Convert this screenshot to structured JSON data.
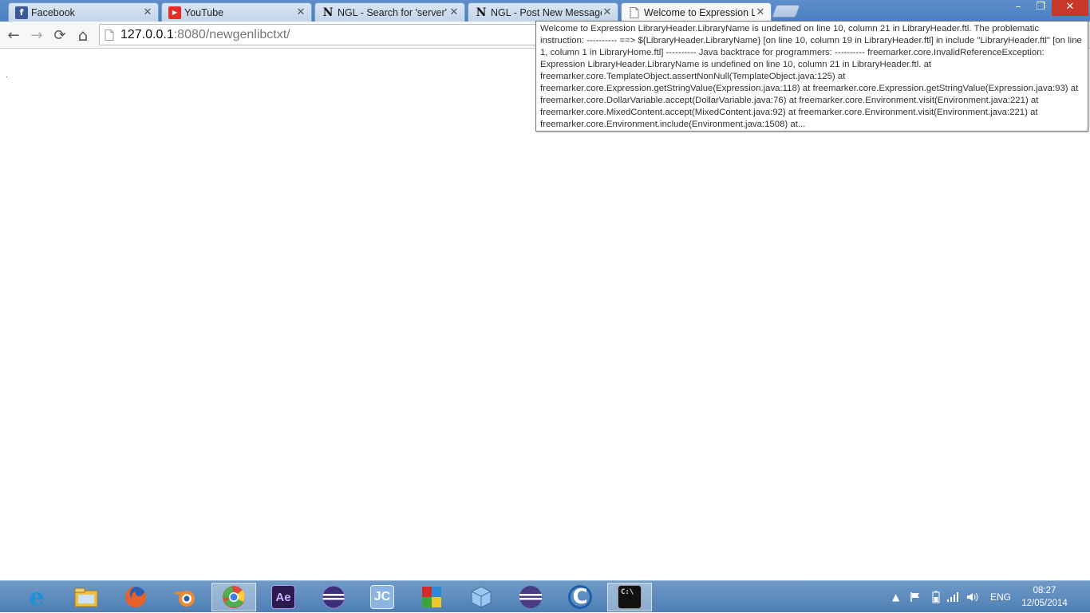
{
  "browser": {
    "tabs": [
      {
        "label": "Facebook",
        "icon": "facebook-icon",
        "active": false
      },
      {
        "label": "YouTube",
        "icon": "youtube-icon",
        "active": false
      },
      {
        "label": "NGL - Search for 'server'",
        "icon": "ngl-icon",
        "active": false
      },
      {
        "label": "NGL - Post New Message",
        "icon": "ngl-icon",
        "active": false
      },
      {
        "label": "Welcome to Expression Lil",
        "icon": "page-icon",
        "active": true
      }
    ],
    "window_controls": {
      "minimize": "–",
      "maximize": "❐",
      "close": "✕"
    },
    "toolbar": {
      "back": "←",
      "forward": "→",
      "reload": "⟳",
      "home": "⌂",
      "url_host": "127.0.0.1",
      "url_rest": ":8080/newgenlibctxt/"
    }
  },
  "page": {
    "tooltip_text": "Welcome to Expression LibraryHeader.LibraryName is undefined on line 10, column 21 in LibraryHeader.ftl. The problematic instruction: ---------- ==> ${LibraryHeader.LibraryName} [on line 10, column 19 in LibraryHeader.ftl] in include \"LibraryHeader.ftl\" [on line 1, column 1 in LibraryHome.ftl] ---------- Java backtrace for programmers: ---------- freemarker.core.InvalidReferenceException: Expression LibraryHeader.LibraryName is undefined on line 10, column 21 in LibraryHeader.ftl. at freemarker.core.TemplateObject.assertNonNull(TemplateObject.java:125) at freemarker.core.Expression.getStringValue(Expression.java:118) at freemarker.core.Expression.getStringValue(Expression.java:93) at freemarker.core.DollarVariable.accept(DollarVariable.java:76) at freemarker.core.Environment.visit(Environment.java:221) at freemarker.core.MixedContent.accept(MixedContent.java:92) at freemarker.core.Environment.visit(Environment.java:221) at freemarker.core.Environment.include(Environment.java:1508) at..."
  },
  "taskbar": {
    "apps": [
      {
        "name": "internet-explorer-icon",
        "glyph": "e",
        "color": "#1e90d8"
      },
      {
        "name": "file-explorer-icon",
        "glyph": "",
        "color": "#e8c04a"
      },
      {
        "name": "firefox-icon",
        "glyph": "",
        "color": "#e6622a"
      },
      {
        "name": "blender-icon",
        "glyph": "",
        "color": "#f0892b"
      },
      {
        "name": "chrome-icon",
        "glyph": "",
        "color": "#dd4b39"
      },
      {
        "name": "after-effects-icon",
        "glyph": "Ae",
        "color": "#2a1a4e"
      },
      {
        "name": "eclipse-icon",
        "glyph": "",
        "color": "#3c2e78"
      },
      {
        "name": "jcreator-icon",
        "glyph": "JC",
        "color": "#5d8fc9"
      },
      {
        "name": "winrar-icon",
        "glyph": "",
        "color": "#9a3c8e"
      },
      {
        "name": "virtualbox-icon",
        "glyph": "",
        "color": "#6ba4dc"
      },
      {
        "name": "eclipse-alt-icon",
        "glyph": "",
        "color": "#4b3a86"
      },
      {
        "name": "ccleaner-icon",
        "glyph": "C",
        "color": "#1c5fb0"
      },
      {
        "name": "command-prompt-icon",
        "glyph": "C:\\",
        "color": "#111111"
      }
    ],
    "tray": {
      "language": "ENG",
      "time": "08:27",
      "date": "12/05/2014"
    }
  }
}
